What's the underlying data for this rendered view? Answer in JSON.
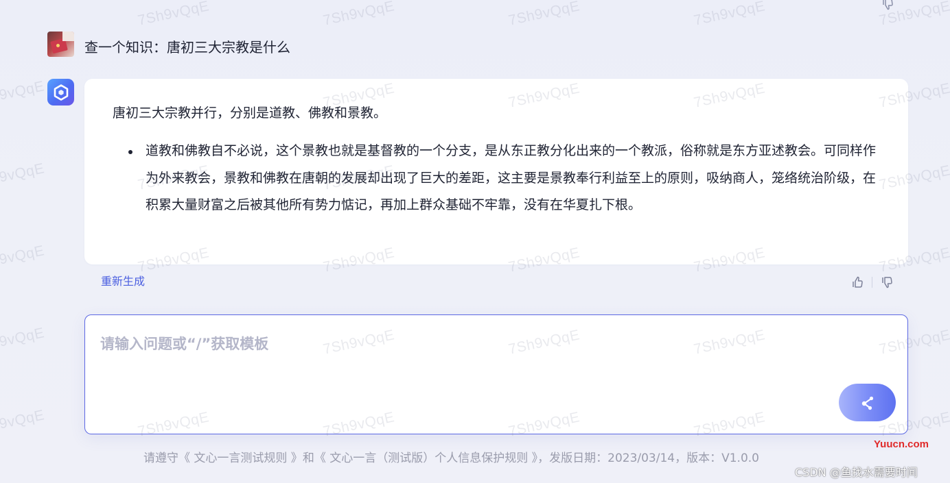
{
  "conversation": {
    "user_question": "查一个知识：唐初三大宗教是什么",
    "answer": {
      "lead": "唐初三大宗教并行，分别是道教、佛教和景教。",
      "bullets": [
        "道教和佛教自不必说，这个景教也就是基督教的一个分支，是从东正教分化出来的一个教派，俗称就是东方亚述教会。可同样作为外来教会，景教和佛教在唐朝的发展却出现了巨大的差距，这主要是景教奉行利益至上的原则，吸纳商人，笼络统治阶级，在积累大量财富之后被其他所有势力惦记，再加上群众基础不牢靠，没有在华夏扎下根。"
      ]
    },
    "regenerate_label": "重新生成"
  },
  "input": {
    "placeholder": "请输入问题或“/”获取模板",
    "value": ""
  },
  "footer": {
    "prefix": "请遵守",
    "link1": "《 文心一言测试规则 》",
    "middle": "和",
    "link2": "《 文心一言（测试版）个人信息保护规则 》",
    "suffix": "，发版日期：2023/03/14，版本：V1.0.0"
  },
  "watermark_text": "7Sh9vQqE",
  "overlays": {
    "site_label": "Yuucn.com",
    "csdn_label": "CSDN @鱼找水需要时间"
  },
  "icons": {
    "user_avatar": "user-avatar-photo",
    "bot_avatar": "ernie-bot-logo-icon",
    "like": "thumbs-up-icon",
    "dislike": "thumbs-down-icon",
    "send": "send-icon"
  },
  "colors": {
    "accent": "#4b5fe0",
    "input_border": "#5b67e3",
    "send_gradient_start": "#a8b4fb",
    "send_gradient_end": "#5d71f0",
    "bot_avatar": "#4d6cf2",
    "background": "#eceef8"
  }
}
